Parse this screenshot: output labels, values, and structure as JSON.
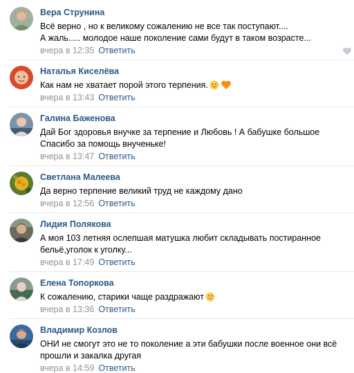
{
  "comments": [
    {
      "author": "Вера Струнина",
      "lines": [
        "Всё верно , но к великому сожалению не все так поступают....",
        "А жаль..... молодое наше поколение сами будут в таком возрасте..."
      ],
      "time": "вчера в 12:35",
      "emoji": []
    },
    {
      "author": "Наталья Киселёва",
      "lines": [
        "Как нам не хватает порой этого терпения."
      ],
      "time": "вчера в 13:43",
      "emoji": [
        "grin-emoji",
        "orange-heart-emoji"
      ]
    },
    {
      "author": "Галина Баженова",
      "lines": [
        "Дай Бог здоровья внучке за терпение и Любовь ! А бабушке большое",
        "Спасибо за помощь внученьке!"
      ],
      "time": "вчера в 13:47",
      "emoji": []
    },
    {
      "author": "Светлана Малеева",
      "lines": [
        "Да верно терпение великий труд не каждому дано"
      ],
      "time": "вчера в 12:56",
      "emoji": []
    },
    {
      "author": "Лидия Полякова",
      "lines": [
        "А моя 103 летняя ослепшая матушка любит складывать постиранное",
        "бельё,уголок к уголку..."
      ],
      "time": "вчера в 17:49",
      "emoji": []
    },
    {
      "author": "Елена Топоркова",
      "lines": [
        "К сожалению, старики чаще раздражают"
      ],
      "time": "вчера в 13:36",
      "emoji": [
        "grin-emoji"
      ]
    },
    {
      "author": "Владимир Козлов",
      "lines": [
        "ОНИ не смогут это не то поколение а эти бабушки после военное они всё",
        "прошли и закалка другая"
      ],
      "time": "вчера в 14:59",
      "emoji": []
    }
  ],
  "reply_label": "Ответить",
  "colors": {
    "author": "#2a5885",
    "meta": "#939393",
    "separator": "#e7e8ec",
    "like_icon": "#c5ccd6"
  }
}
